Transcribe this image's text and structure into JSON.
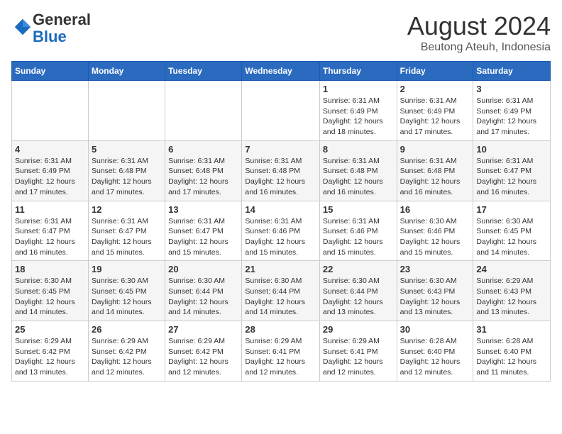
{
  "header": {
    "logo_general": "General",
    "logo_blue": "Blue",
    "month_title": "August 2024",
    "subtitle": "Beutong Ateuh, Indonesia"
  },
  "days_of_week": [
    "Sunday",
    "Monday",
    "Tuesday",
    "Wednesday",
    "Thursday",
    "Friday",
    "Saturday"
  ],
  "weeks": [
    [
      {
        "day": "",
        "info": ""
      },
      {
        "day": "",
        "info": ""
      },
      {
        "day": "",
        "info": ""
      },
      {
        "day": "",
        "info": ""
      },
      {
        "day": "1",
        "info": "Sunrise: 6:31 AM\nSunset: 6:49 PM\nDaylight: 12 hours and 18 minutes."
      },
      {
        "day": "2",
        "info": "Sunrise: 6:31 AM\nSunset: 6:49 PM\nDaylight: 12 hours and 17 minutes."
      },
      {
        "day": "3",
        "info": "Sunrise: 6:31 AM\nSunset: 6:49 PM\nDaylight: 12 hours and 17 minutes."
      }
    ],
    [
      {
        "day": "4",
        "info": "Sunrise: 6:31 AM\nSunset: 6:49 PM\nDaylight: 12 hours and 17 minutes."
      },
      {
        "day": "5",
        "info": "Sunrise: 6:31 AM\nSunset: 6:48 PM\nDaylight: 12 hours and 17 minutes."
      },
      {
        "day": "6",
        "info": "Sunrise: 6:31 AM\nSunset: 6:48 PM\nDaylight: 12 hours and 17 minutes."
      },
      {
        "day": "7",
        "info": "Sunrise: 6:31 AM\nSunset: 6:48 PM\nDaylight: 12 hours and 16 minutes."
      },
      {
        "day": "8",
        "info": "Sunrise: 6:31 AM\nSunset: 6:48 PM\nDaylight: 12 hours and 16 minutes."
      },
      {
        "day": "9",
        "info": "Sunrise: 6:31 AM\nSunset: 6:48 PM\nDaylight: 12 hours and 16 minutes."
      },
      {
        "day": "10",
        "info": "Sunrise: 6:31 AM\nSunset: 6:47 PM\nDaylight: 12 hours and 16 minutes."
      }
    ],
    [
      {
        "day": "11",
        "info": "Sunrise: 6:31 AM\nSunset: 6:47 PM\nDaylight: 12 hours and 16 minutes."
      },
      {
        "day": "12",
        "info": "Sunrise: 6:31 AM\nSunset: 6:47 PM\nDaylight: 12 hours and 15 minutes."
      },
      {
        "day": "13",
        "info": "Sunrise: 6:31 AM\nSunset: 6:47 PM\nDaylight: 12 hours and 15 minutes."
      },
      {
        "day": "14",
        "info": "Sunrise: 6:31 AM\nSunset: 6:46 PM\nDaylight: 12 hours and 15 minutes."
      },
      {
        "day": "15",
        "info": "Sunrise: 6:31 AM\nSunset: 6:46 PM\nDaylight: 12 hours and 15 minutes."
      },
      {
        "day": "16",
        "info": "Sunrise: 6:30 AM\nSunset: 6:46 PM\nDaylight: 12 hours and 15 minutes."
      },
      {
        "day": "17",
        "info": "Sunrise: 6:30 AM\nSunset: 6:45 PM\nDaylight: 12 hours and 14 minutes."
      }
    ],
    [
      {
        "day": "18",
        "info": "Sunrise: 6:30 AM\nSunset: 6:45 PM\nDaylight: 12 hours and 14 minutes."
      },
      {
        "day": "19",
        "info": "Sunrise: 6:30 AM\nSunset: 6:45 PM\nDaylight: 12 hours and 14 minutes."
      },
      {
        "day": "20",
        "info": "Sunrise: 6:30 AM\nSunset: 6:44 PM\nDaylight: 12 hours and 14 minutes."
      },
      {
        "day": "21",
        "info": "Sunrise: 6:30 AM\nSunset: 6:44 PM\nDaylight: 12 hours and 14 minutes."
      },
      {
        "day": "22",
        "info": "Sunrise: 6:30 AM\nSunset: 6:44 PM\nDaylight: 12 hours and 13 minutes."
      },
      {
        "day": "23",
        "info": "Sunrise: 6:30 AM\nSunset: 6:43 PM\nDaylight: 12 hours and 13 minutes."
      },
      {
        "day": "24",
        "info": "Sunrise: 6:29 AM\nSunset: 6:43 PM\nDaylight: 12 hours and 13 minutes."
      }
    ],
    [
      {
        "day": "25",
        "info": "Sunrise: 6:29 AM\nSunset: 6:42 PM\nDaylight: 12 hours and 13 minutes."
      },
      {
        "day": "26",
        "info": "Sunrise: 6:29 AM\nSunset: 6:42 PM\nDaylight: 12 hours and 12 minutes."
      },
      {
        "day": "27",
        "info": "Sunrise: 6:29 AM\nSunset: 6:42 PM\nDaylight: 12 hours and 12 minutes."
      },
      {
        "day": "28",
        "info": "Sunrise: 6:29 AM\nSunset: 6:41 PM\nDaylight: 12 hours and 12 minutes."
      },
      {
        "day": "29",
        "info": "Sunrise: 6:29 AM\nSunset: 6:41 PM\nDaylight: 12 hours and 12 minutes."
      },
      {
        "day": "30",
        "info": "Sunrise: 6:28 AM\nSunset: 6:40 PM\nDaylight: 12 hours and 12 minutes."
      },
      {
        "day": "31",
        "info": "Sunrise: 6:28 AM\nSunset: 6:40 PM\nDaylight: 12 hours and 11 minutes."
      }
    ]
  ]
}
